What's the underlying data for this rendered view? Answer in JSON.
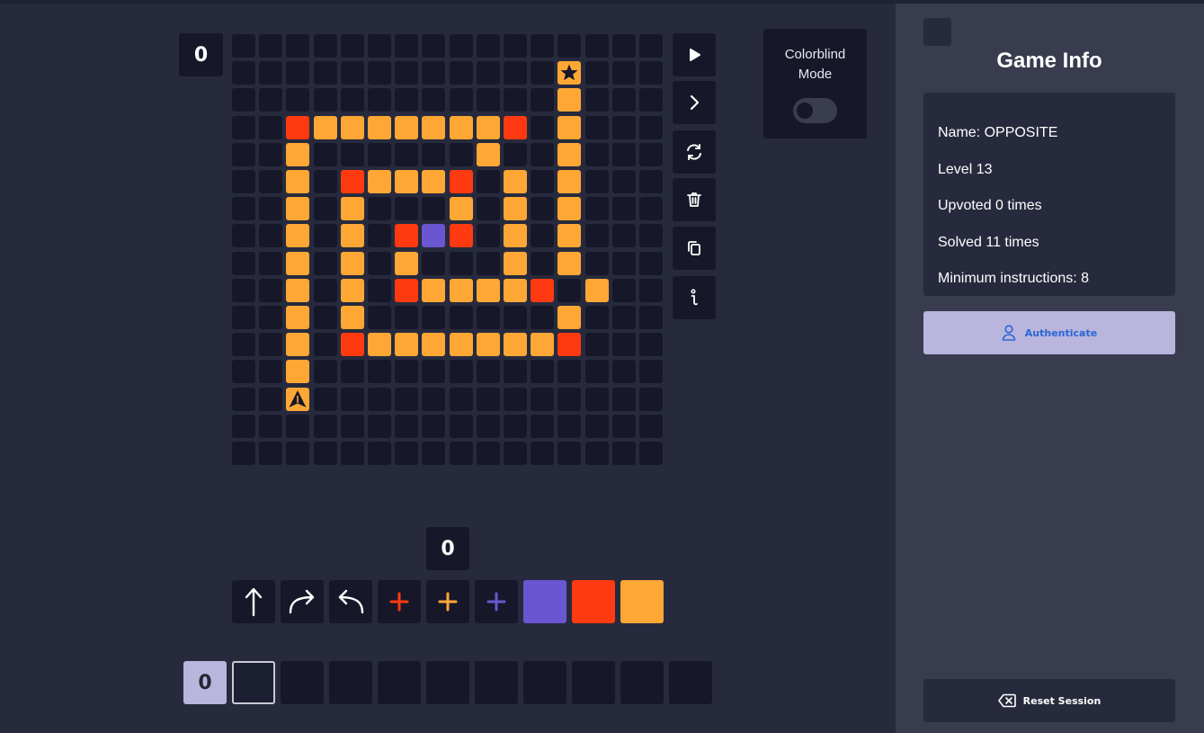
{
  "board": {
    "step_counter": "0",
    "rows": [
      "................",
      "............*...",
      "............o...",
      "..rooooooor.o...",
      "..o......o..o...",
      "..o.rooor.o.o...",
      "..o.o...o.o.o...",
      "..o.o.rpr.o.o...",
      "..o.o.o...o.o...",
      "..o.o.roooor.o..",
      "..o.o.......o...",
      "..o.rooooooor...",
      "..o.............",
      "..^.............",
      "................",
      "................"
    ],
    "legend": {
      "o": "#ffa735",
      "r": "#ff3a11",
      "p": "#6a56d0",
      "*": "star-goal",
      "^": "player-arrow"
    }
  },
  "controls": [
    {
      "name": "play-button",
      "icon": "play-icon"
    },
    {
      "name": "step-button",
      "icon": "chevron-right-icon"
    },
    {
      "name": "reset-board-button",
      "icon": "refresh-icon"
    },
    {
      "name": "delete-button",
      "icon": "trash-icon"
    },
    {
      "name": "copy-button",
      "icon": "copy-icon"
    },
    {
      "name": "info-button",
      "icon": "info-icon"
    }
  ],
  "colorblind": {
    "label_line1": "Colorblind",
    "label_line2": "Mode",
    "enabled": false
  },
  "toolbar": {
    "counter": "0",
    "tools": [
      {
        "name": "forward-tool",
        "icon": "arrow-up-icon"
      },
      {
        "name": "turn-right-tool",
        "icon": "turn-right-icon"
      },
      {
        "name": "turn-left-tool",
        "icon": "turn-left-icon"
      },
      {
        "name": "paint-red-tool",
        "icon": "plus-icon",
        "color": "#ff3a11"
      },
      {
        "name": "paint-orange-tool",
        "icon": "plus-icon",
        "color": "#ffa735"
      },
      {
        "name": "paint-purple-tool",
        "icon": "plus-icon",
        "color": "#6a56d0"
      },
      {
        "name": "cond-purple-tool",
        "color": "#6a56d0"
      },
      {
        "name": "cond-red-tool",
        "color": "#ff3a11"
      },
      {
        "name": "cond-orange-tool",
        "color": "#ffa735"
      }
    ]
  },
  "program": {
    "label": "0",
    "slots": 10
  },
  "game_info": {
    "title": "Game Info",
    "name": "Name: OPPOSITE",
    "level": "Level 13",
    "upvoted": "Upvoted 0 times",
    "solved": "Solved 11 times",
    "min_instructions": "Minimum instructions: 8"
  },
  "auth_button": {
    "label": "Authenticate",
    "icon": "user-icon"
  },
  "reset_button": {
    "label": "Reset Session",
    "icon": "backspace-icon"
  }
}
